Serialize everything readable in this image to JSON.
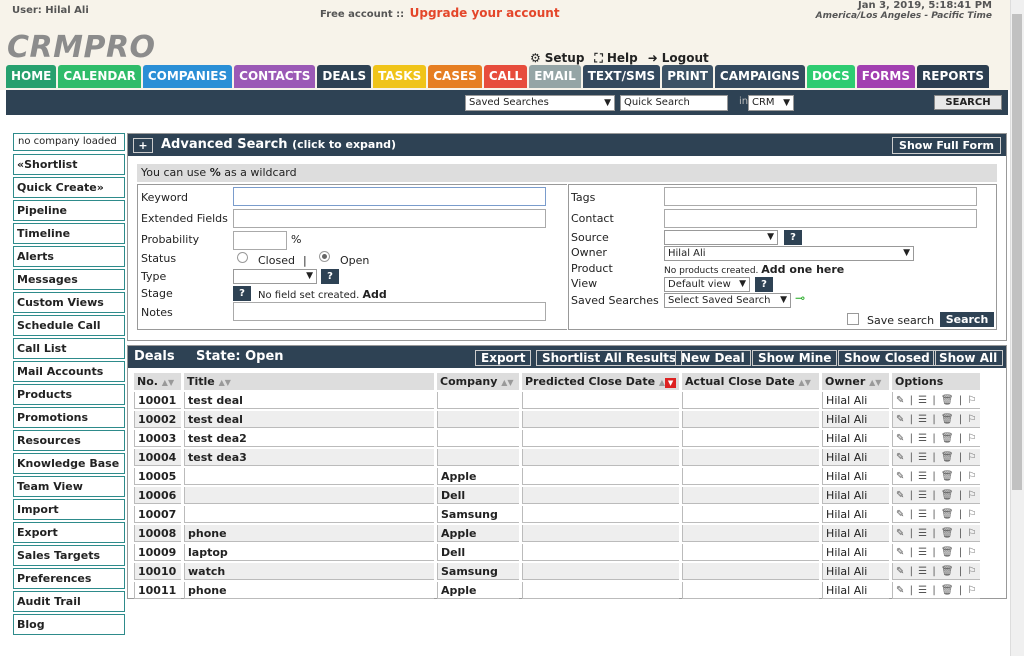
{
  "header": {
    "user_label": "User: Hilal Ali",
    "free_label": "Free account ::",
    "upgrade": "Upgrade your account",
    "datetime": "Jan 3, 2019, 5:18:41 PM",
    "timezone": "America/Los Angeles - Pacific Time",
    "logo": "CRMPRO",
    "links": {
      "setup": "Setup",
      "help": "Help",
      "logout": "Logout"
    }
  },
  "nav": {
    "tabs": [
      {
        "label": "HOME",
        "color": "#27a06e"
      },
      {
        "label": "CALENDAR",
        "color": "#2fbc6a"
      },
      {
        "label": "COMPANIES",
        "color": "#2a8fd6"
      },
      {
        "label": "CONTACTS",
        "color": "#9b59b6"
      },
      {
        "label": "DEALS",
        "color": "#2e4254"
      },
      {
        "label": "TASKS",
        "color": "#f0c419"
      },
      {
        "label": "CASES",
        "color": "#e67e22"
      },
      {
        "label": "CALL",
        "color": "#e74c3c"
      },
      {
        "label": "EMAIL",
        "color": "#95a5a6"
      },
      {
        "label": "TEXT/SMS",
        "color": "#34495e"
      },
      {
        "label": "PRINT",
        "color": "#3d5366"
      },
      {
        "label": "CAMPAIGNS",
        "color": "#34495e"
      },
      {
        "label": "DOCS",
        "color": "#2ecc71"
      },
      {
        "label": "FORMS",
        "color": "#a23fb0"
      },
      {
        "label": "REPORTS",
        "color": "#2c3e50"
      }
    ]
  },
  "searchbar": {
    "saved_searches": "Saved Searches",
    "quick_search": "Quick Search",
    "in_label": "in",
    "scope": "CRM",
    "search_button": "SEARCH"
  },
  "sidebar": {
    "company_status": "no company loaded",
    "items": [
      "«Shortlist",
      "Quick Create»",
      "Pipeline",
      "Timeline",
      "Alerts",
      "Messages",
      "Custom Views",
      "Schedule Call",
      "Call List",
      "Mail Accounts",
      "Products",
      "Promotions",
      "Resources",
      "Knowledge Base",
      "Team View",
      "Import",
      "Export",
      "Sales Targets",
      "Preferences",
      "Audit Trail",
      "Blog"
    ]
  },
  "advanced_search": {
    "plus": "+",
    "title": "Advanced Search",
    "subtitle": "(click to expand)",
    "show_full_form": "Show Full Form",
    "wildcard_pre": "You can use",
    "wildcard_sym": "%",
    "wildcard_post": "as a wildcard",
    "left": {
      "keyword": "Keyword",
      "extended": "Extended Fields",
      "probability": "Probability",
      "percent": "%",
      "status": "Status",
      "closed": "Closed",
      "sep": "|",
      "open": "Open",
      "type": "Type",
      "stage": "Stage",
      "stage_note": "No field set created.",
      "stage_add": "Add",
      "notes": "Notes"
    },
    "right": {
      "tags": "Tags",
      "contact": "Contact",
      "source": "Source",
      "owner": "Owner",
      "owner_value": "Hilal Ali",
      "product": "Product",
      "product_note": "No products created.",
      "product_add": "Add one here",
      "view": "View",
      "view_value": "Default view",
      "saved": "Saved Searches",
      "saved_value": "Select Saved Search",
      "save_search": "Save search",
      "search_button": "Search"
    },
    "help": "?"
  },
  "deals": {
    "title": "Deals",
    "state": "State: Open",
    "buttons": {
      "export": "Export",
      "shortlist": "Shortlist All Results",
      "new": "New Deal",
      "mine": "Show Mine",
      "closed": "Show Closed",
      "all": "Show All"
    },
    "columns": [
      "No.",
      "Title",
      "Company",
      "Predicted Close Date",
      "Actual Close Date",
      "Owner",
      "Options"
    ],
    "rows": [
      {
        "no": "10001",
        "title": "test deal",
        "company": "",
        "owner": "Hilal Ali"
      },
      {
        "no": "10002",
        "title": "test deal",
        "company": "",
        "owner": "Hilal Ali"
      },
      {
        "no": "10003",
        "title": "test dea2",
        "company": "",
        "owner": "Hilal Ali"
      },
      {
        "no": "10004",
        "title": "test dea3",
        "company": "",
        "owner": "Hilal Ali"
      },
      {
        "no": "10005",
        "title": "",
        "company": "Apple",
        "owner": "Hilal Ali"
      },
      {
        "no": "10006",
        "title": "",
        "company": "Dell",
        "owner": "Hilal Ali"
      },
      {
        "no": "10007",
        "title": "",
        "company": "Samsung",
        "owner": "Hilal Ali"
      },
      {
        "no": "10008",
        "title": "phone",
        "company": "Apple",
        "owner": "Hilal Ali"
      },
      {
        "no": "10009",
        "title": "laptop",
        "company": "Dell",
        "owner": "Hilal Ali"
      },
      {
        "no": "10010",
        "title": "watch",
        "company": "Samsung",
        "owner": "Hilal Ali"
      },
      {
        "no": "10011",
        "title": "phone",
        "company": "Apple",
        "owner": "Hilal Ali"
      }
    ]
  }
}
